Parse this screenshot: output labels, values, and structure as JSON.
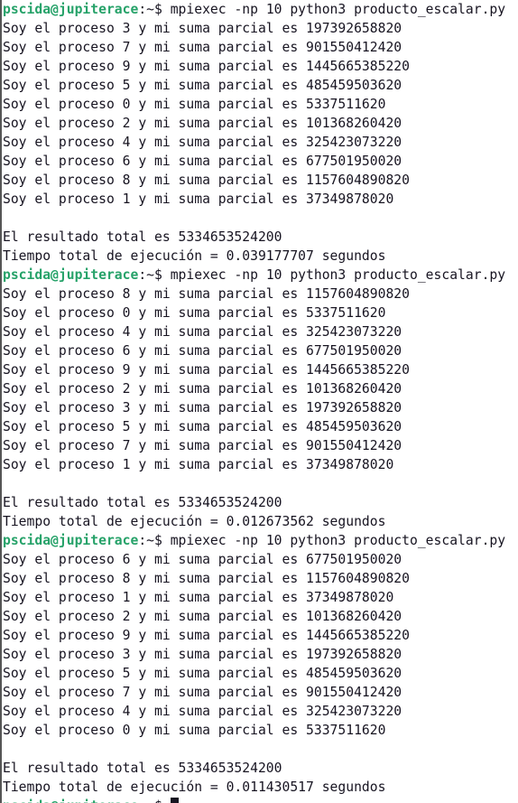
{
  "colors": {
    "background": "#ffffff",
    "foreground": "#171421",
    "prompt_user_host": "#26a269"
  },
  "prompt": {
    "user_host": "pscida@jupiterace",
    "separator": ":~$ "
  },
  "lines": [
    {
      "type": "prompt",
      "command": "mpiexec -np 10 python3 producto_escalar.py"
    },
    {
      "type": "text",
      "text": "Soy el proceso 3 y mi suma parcial es 197392658820"
    },
    {
      "type": "text",
      "text": "Soy el proceso 7 y mi suma parcial es 901550412420"
    },
    {
      "type": "text",
      "text": "Soy el proceso 9 y mi suma parcial es 1445665385220"
    },
    {
      "type": "text",
      "text": "Soy el proceso 5 y mi suma parcial es 485459503620"
    },
    {
      "type": "text",
      "text": "Soy el proceso 0 y mi suma parcial es 5337511620"
    },
    {
      "type": "text",
      "text": "Soy el proceso 2 y mi suma parcial es 101368260420"
    },
    {
      "type": "text",
      "text": "Soy el proceso 4 y mi suma parcial es 325423073220"
    },
    {
      "type": "text",
      "text": "Soy el proceso 6 y mi suma parcial es 677501950020"
    },
    {
      "type": "text",
      "text": "Soy el proceso 8 y mi suma parcial es 1157604890820"
    },
    {
      "type": "text",
      "text": "Soy el proceso 1 y mi suma parcial es 37349878020"
    },
    {
      "type": "text",
      "text": ""
    },
    {
      "type": "text",
      "text": "El resultado total es 5334653524200"
    },
    {
      "type": "text",
      "text": "Tiempo total de ejecución = 0.039177707 segundos"
    },
    {
      "type": "prompt",
      "command": "mpiexec -np 10 python3 producto_escalar.py"
    },
    {
      "type": "text",
      "text": "Soy el proceso 8 y mi suma parcial es 1157604890820"
    },
    {
      "type": "text",
      "text": "Soy el proceso 0 y mi suma parcial es 5337511620"
    },
    {
      "type": "text",
      "text": "Soy el proceso 4 y mi suma parcial es 325423073220"
    },
    {
      "type": "text",
      "text": "Soy el proceso 6 y mi suma parcial es 677501950020"
    },
    {
      "type": "text",
      "text": "Soy el proceso 9 y mi suma parcial es 1445665385220"
    },
    {
      "type": "text",
      "text": "Soy el proceso 2 y mi suma parcial es 101368260420"
    },
    {
      "type": "text",
      "text": "Soy el proceso 3 y mi suma parcial es 197392658820"
    },
    {
      "type": "text",
      "text": "Soy el proceso 5 y mi suma parcial es 485459503620"
    },
    {
      "type": "text",
      "text": "Soy el proceso 7 y mi suma parcial es 901550412420"
    },
    {
      "type": "text",
      "text": "Soy el proceso 1 y mi suma parcial es 37349878020"
    },
    {
      "type": "text",
      "text": ""
    },
    {
      "type": "text",
      "text": "El resultado total es 5334653524200"
    },
    {
      "type": "text",
      "text": "Tiempo total de ejecución = 0.012673562 segundos"
    },
    {
      "type": "prompt",
      "command": "mpiexec -np 10 python3 producto_escalar.py"
    },
    {
      "type": "text",
      "text": "Soy el proceso 6 y mi suma parcial es 677501950020"
    },
    {
      "type": "text",
      "text": "Soy el proceso 8 y mi suma parcial es 1157604890820"
    },
    {
      "type": "text",
      "text": "Soy el proceso 1 y mi suma parcial es 37349878020"
    },
    {
      "type": "text",
      "text": "Soy el proceso 2 y mi suma parcial es 101368260420"
    },
    {
      "type": "text",
      "text": "Soy el proceso 9 y mi suma parcial es 1445665385220"
    },
    {
      "type": "text",
      "text": "Soy el proceso 3 y mi suma parcial es 197392658820"
    },
    {
      "type": "text",
      "text": "Soy el proceso 5 y mi suma parcial es 485459503620"
    },
    {
      "type": "text",
      "text": "Soy el proceso 7 y mi suma parcial es 901550412420"
    },
    {
      "type": "text",
      "text": "Soy el proceso 4 y mi suma parcial es 325423073220"
    },
    {
      "type": "text",
      "text": "Soy el proceso 0 y mi suma parcial es 5337511620"
    },
    {
      "type": "text",
      "text": ""
    },
    {
      "type": "text",
      "text": "El resultado total es 5334653524200"
    },
    {
      "type": "text",
      "text": "Tiempo total de ejecución = 0.011430517 segundos"
    },
    {
      "type": "prompt",
      "command": "",
      "cursor": true
    }
  ]
}
